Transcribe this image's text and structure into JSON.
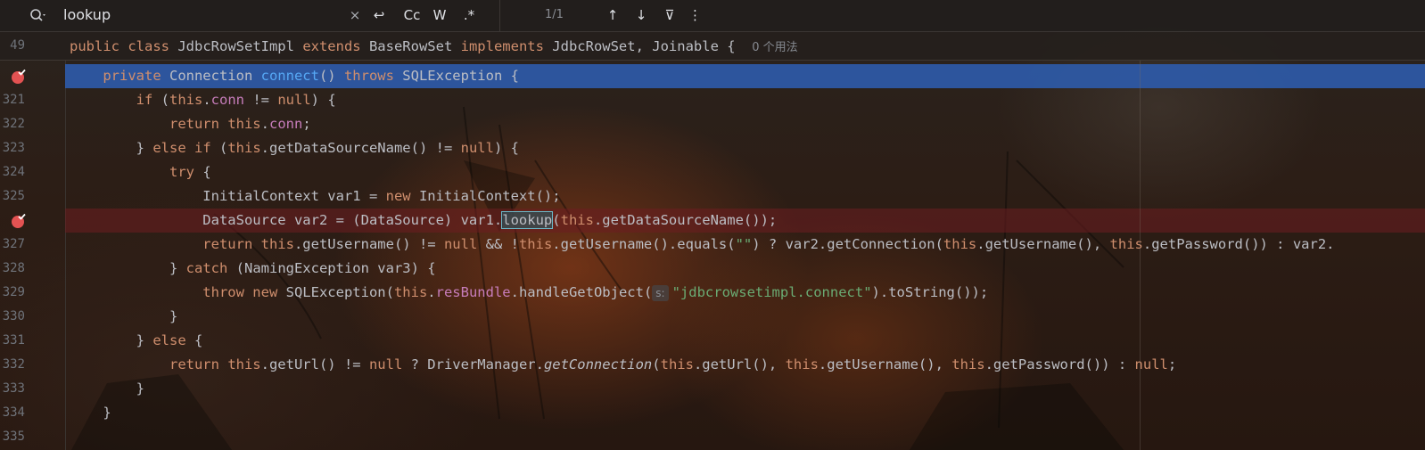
{
  "search": {
    "query": "lookup",
    "close_glyph": "×",
    "wrap_glyph": "↩",
    "case_label": "Cc",
    "words_label": "W",
    "regex_label": ".*",
    "match_count": "1/1",
    "prev_glyph": "↑",
    "next_glyph": "↓",
    "filter_glyph": "⊽",
    "more_glyph": "⋮"
  },
  "header": {
    "line": "49",
    "code": [
      {
        "t": "public ",
        "c": "kw"
      },
      {
        "t": "class ",
        "c": "kw"
      },
      {
        "t": "JdbcRowSetImpl ",
        "c": ""
      },
      {
        "t": "extends ",
        "c": "kw"
      },
      {
        "t": "BaseRowSet ",
        "c": ""
      },
      {
        "t": "implements ",
        "c": "kw"
      },
      {
        "t": "JdbcRowSet, Joinable {  ",
        "c": ""
      }
    ],
    "usage_hint": "0 个用法"
  },
  "lines": [
    {
      "ln": "",
      "type": "exec",
      "breakpoint": true,
      "tokens": [
        {
          "t": "    private ",
          "c": "kw"
        },
        {
          "t": "Connection ",
          "c": ""
        },
        {
          "t": "connect",
          "c": "fn"
        },
        {
          "t": "() ",
          "c": ""
        },
        {
          "t": "throws ",
          "c": "kw"
        },
        {
          "t": "SQLException {",
          "c": ""
        }
      ]
    },
    {
      "ln": "321",
      "type": "",
      "tokens": [
        {
          "t": "        if ",
          "c": "kw"
        },
        {
          "t": "(",
          "c": ""
        },
        {
          "t": "this",
          "c": "kw"
        },
        {
          "t": ".",
          "c": ""
        },
        {
          "t": "conn",
          "c": "fld"
        },
        {
          "t": " != ",
          "c": ""
        },
        {
          "t": "null",
          "c": "kw"
        },
        {
          "t": ") {",
          "c": ""
        }
      ]
    },
    {
      "ln": "322",
      "type": "",
      "tokens": [
        {
          "t": "            return ",
          "c": "kw"
        },
        {
          "t": "this",
          "c": "kw"
        },
        {
          "t": ".",
          "c": ""
        },
        {
          "t": "conn",
          "c": "fld"
        },
        {
          "t": ";",
          "c": ""
        }
      ]
    },
    {
      "ln": "323",
      "type": "",
      "tokens": [
        {
          "t": "        } ",
          "c": ""
        },
        {
          "t": "else if ",
          "c": "kw"
        },
        {
          "t": "(",
          "c": ""
        },
        {
          "t": "this",
          "c": "kw"
        },
        {
          "t": ".getDataSourceName() != ",
          "c": ""
        },
        {
          "t": "null",
          "c": "kw"
        },
        {
          "t": ") {",
          "c": ""
        }
      ]
    },
    {
      "ln": "324",
      "type": "",
      "tokens": [
        {
          "t": "            try ",
          "c": "kw"
        },
        {
          "t": "{",
          "c": ""
        }
      ]
    },
    {
      "ln": "325",
      "type": "",
      "tokens": [
        {
          "t": "                InitialContext var1 = ",
          "c": ""
        },
        {
          "t": "new ",
          "c": "kw"
        },
        {
          "t": "InitialContext();",
          "c": ""
        }
      ]
    },
    {
      "ln": "",
      "type": "bp",
      "breakpoint": true,
      "tokens": [
        {
          "t": "                DataSource var2 = (DataSource) var1.",
          "c": ""
        },
        {
          "t": "lookup",
          "c": "match"
        },
        {
          "t": "(",
          "c": ""
        },
        {
          "t": "this",
          "c": "kw"
        },
        {
          "t": ".getDataSourceName());",
          "c": ""
        }
      ]
    },
    {
      "ln": "327",
      "type": "",
      "tokens": [
        {
          "t": "                return ",
          "c": "kw"
        },
        {
          "t": "this",
          "c": "kw"
        },
        {
          "t": ".getUsername() != ",
          "c": ""
        },
        {
          "t": "null",
          "c": "kw"
        },
        {
          "t": " && !",
          "c": ""
        },
        {
          "t": "this",
          "c": "kw"
        },
        {
          "t": ".getUsername().equals(",
          "c": ""
        },
        {
          "t": "\"\"",
          "c": "str"
        },
        {
          "t": ") ? var2.getConnection(",
          "c": ""
        },
        {
          "t": "this",
          "c": "kw"
        },
        {
          "t": ".getUsername(), ",
          "c": ""
        },
        {
          "t": "this",
          "c": "kw"
        },
        {
          "t": ".getPassword()) : var2.",
          "c": ""
        }
      ]
    },
    {
      "ln": "328",
      "type": "",
      "tokens": [
        {
          "t": "            } ",
          "c": ""
        },
        {
          "t": "catch ",
          "c": "kw"
        },
        {
          "t": "(NamingException var3) {",
          "c": ""
        }
      ]
    },
    {
      "ln": "329",
      "type": "",
      "tokens": [
        {
          "t": "                throw new ",
          "c": "kw"
        },
        {
          "t": "SQLException(",
          "c": ""
        },
        {
          "t": "this",
          "c": "kw"
        },
        {
          "t": ".",
          "c": ""
        },
        {
          "t": "resBundle",
          "c": "fld"
        },
        {
          "t": ".handleGetObject(",
          "c": ""
        },
        {
          "t": "s:",
          "c": "hint"
        },
        {
          "t": "\"jdbcrowsetimpl.connect\"",
          "c": "str"
        },
        {
          "t": ").toString());",
          "c": ""
        }
      ]
    },
    {
      "ln": "330",
      "type": "",
      "tokens": [
        {
          "t": "            }",
          "c": ""
        }
      ]
    },
    {
      "ln": "331",
      "type": "",
      "tokens": [
        {
          "t": "        } ",
          "c": ""
        },
        {
          "t": "else ",
          "c": "kw"
        },
        {
          "t": "{",
          "c": ""
        }
      ]
    },
    {
      "ln": "332",
      "type": "",
      "tokens": [
        {
          "t": "            return ",
          "c": "kw"
        },
        {
          "t": "this",
          "c": "kw"
        },
        {
          "t": ".getUrl() != ",
          "c": ""
        },
        {
          "t": "null",
          "c": "kw"
        },
        {
          "t": " ? DriverManager.",
          "c": ""
        },
        {
          "t": "getConnection",
          "c": "it"
        },
        {
          "t": "(",
          "c": ""
        },
        {
          "t": "this",
          "c": "kw"
        },
        {
          "t": ".getUrl(), ",
          "c": ""
        },
        {
          "t": "this",
          "c": "kw"
        },
        {
          "t": ".getUsername(), ",
          "c": ""
        },
        {
          "t": "this",
          "c": "kw"
        },
        {
          "t": ".getPassword()) : ",
          "c": ""
        },
        {
          "t": "null",
          "c": "kw"
        },
        {
          "t": ";",
          "c": ""
        }
      ]
    },
    {
      "ln": "333",
      "type": "",
      "tokens": [
        {
          "t": "        }",
          "c": ""
        }
      ]
    },
    {
      "ln": "334",
      "type": "",
      "tokens": [
        {
          "t": "    }",
          "c": ""
        }
      ]
    },
    {
      "ln": "335",
      "type": "",
      "tokens": []
    }
  ],
  "colors": {
    "keyword": "#cf8e6d",
    "function": "#56a8f5",
    "field": "#c77dbb",
    "string": "#6aab73",
    "exec_line": "#2e5aa8",
    "breakpoint": "#e35252"
  }
}
